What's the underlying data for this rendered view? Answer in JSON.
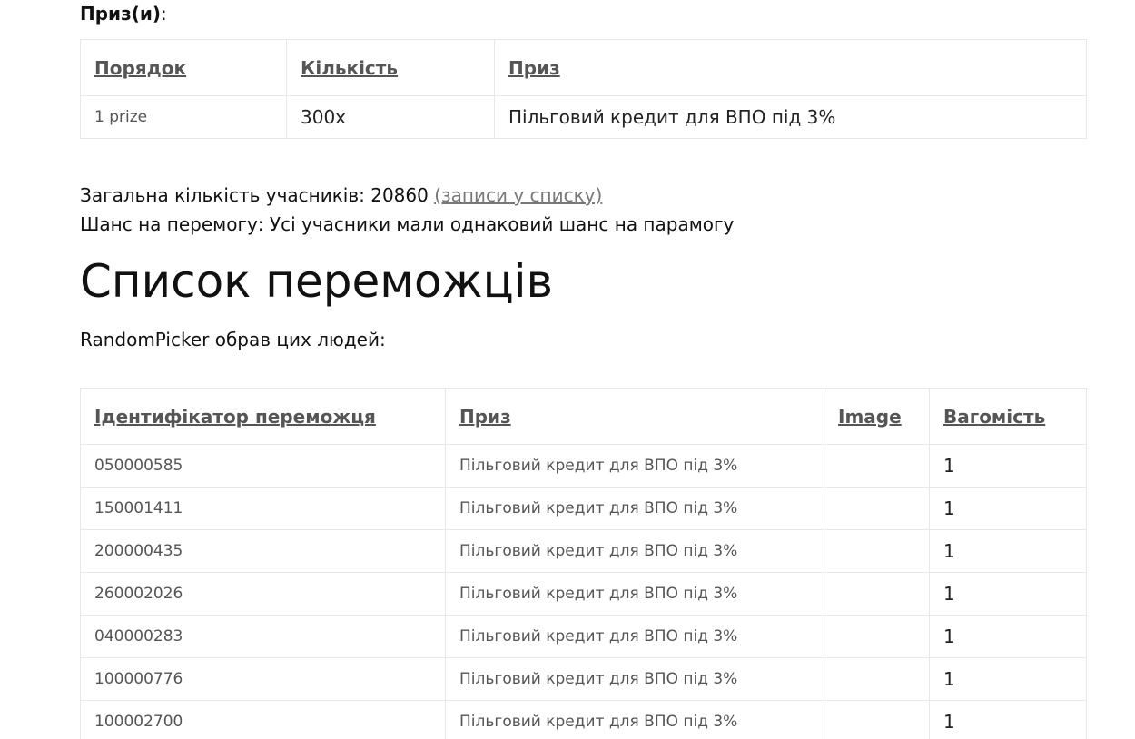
{
  "prizes_heading": "Приз(и)",
  "prizes_heading_suffix": ":",
  "prizes_table": {
    "headers": [
      "Порядок",
      "Кількість",
      "Приз"
    ],
    "rows": [
      {
        "order": "1 prize",
        "quantity": "300x",
        "prize": "Пільговий кредит для ВПО під 3%"
      }
    ]
  },
  "info": {
    "participants_label": "Загальна кількість учасників: 20860",
    "participants_link": "(записи у списку)",
    "chance_text": "Шанс на перемогу: Усі учасники мали однаковий шанс на парамогу"
  },
  "winners_title": "Список переможців",
  "winners_intro": "RandomPicker обрав цих людей:",
  "winners_table": {
    "headers": [
      "Ідентифікатор переможця",
      "Приз",
      "Image",
      "Вагомість"
    ],
    "rows": [
      {
        "id": "050000585",
        "prize": "Пільговий кредит для ВПО під 3%",
        "image": "",
        "weight": "1"
      },
      {
        "id": "150001411",
        "prize": "Пільговий кредит для ВПО під 3%",
        "image": "",
        "weight": "1"
      },
      {
        "id": "200000435",
        "prize": "Пільговий кредит для ВПО під 3%",
        "image": "",
        "weight": "1"
      },
      {
        "id": "260002026",
        "prize": "Пільговий кредит для ВПО під 3%",
        "image": "",
        "weight": "1"
      },
      {
        "id": "040000283",
        "prize": "Пільговий кредит для ВПО під 3%",
        "image": "",
        "weight": "1"
      },
      {
        "id": "100000776",
        "prize": "Пільговий кредит для ВПО під 3%",
        "image": "",
        "weight": "1"
      },
      {
        "id": "100002700",
        "prize": "Пільговий кредит для ВПО під 3%",
        "image": "",
        "weight": "1"
      }
    ]
  }
}
